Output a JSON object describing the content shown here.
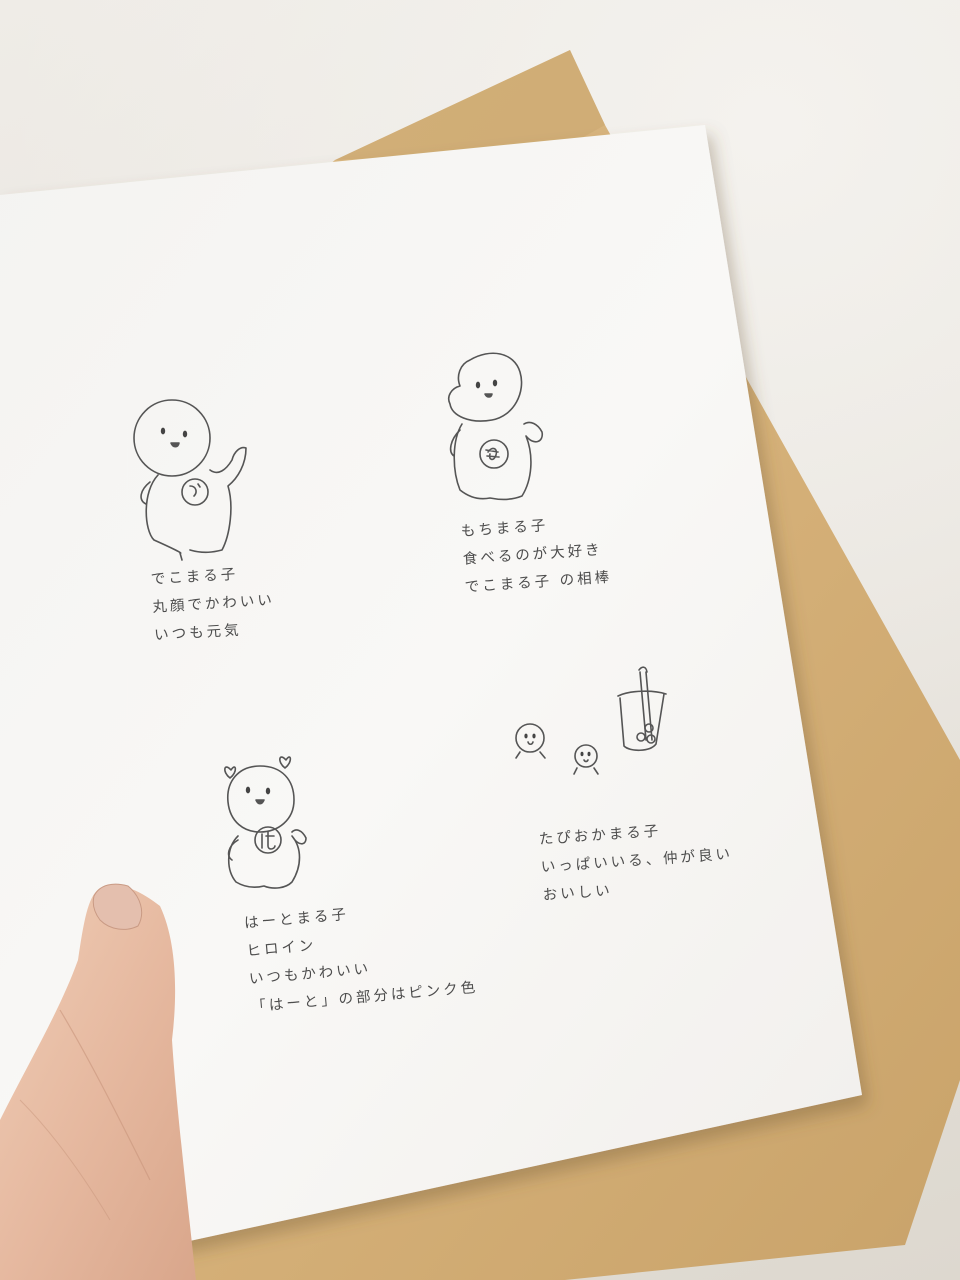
{
  "photo": {
    "subject": "hand-drawn-character-sheet"
  },
  "characters": [
    {
      "id": "dekomaruko",
      "badge": "で",
      "lines": [
        "でこまる子",
        "丸顔でかわいい",
        "いつも元気"
      ]
    },
    {
      "id": "mochimaruko",
      "badge": "も",
      "lines": [
        "もちまる子",
        "食べるのが大好き",
        "でこまる子 の相棒"
      ]
    },
    {
      "id": "haatomaruko",
      "badge": "は",
      "lines": [
        "はーとまる子",
        "ヒロイン",
        "いつもかわいい",
        "「はーと」の部分はピンク色"
      ]
    },
    {
      "id": "tapiokamaruko",
      "badge": "",
      "lines": [
        "たぴおかまる子",
        "いっぱいいる、仲が良い",
        "おいしい"
      ]
    }
  ],
  "colors": {
    "wall": "#ebe8e2",
    "paper": "#f9f8f6",
    "envelope": "#d8b57e",
    "pencil": "#4d4d4d",
    "skin": "#e8bfa8"
  }
}
